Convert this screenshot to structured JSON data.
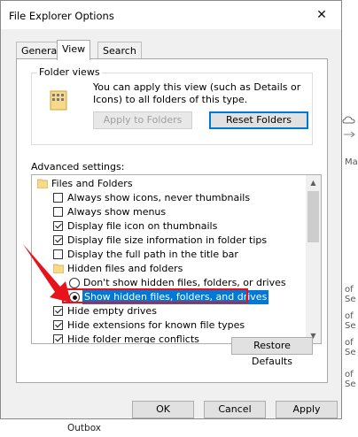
{
  "window": {
    "title": "File Explorer Options"
  },
  "tabs": [
    {
      "label": "General"
    },
    {
      "label": "View",
      "active": true
    },
    {
      "label": "Search"
    }
  ],
  "folder_views": {
    "label": "Folder views",
    "description": "You can apply this view (such as Details or Icons) to all folders of this type.",
    "apply_button": "Apply to Folders",
    "reset_button": "Reset Folders"
  },
  "advanced": {
    "label": "Advanced settings:",
    "items": [
      {
        "type": "folder",
        "text": "Files and Folders"
      },
      {
        "type": "checkbox",
        "checked": false,
        "text": "Always show icons, never thumbnails"
      },
      {
        "type": "checkbox",
        "checked": false,
        "text": "Always show menus"
      },
      {
        "type": "checkbox",
        "checked": true,
        "text": "Display file icon on thumbnails"
      },
      {
        "type": "checkbox",
        "checked": true,
        "text": "Display file size information in folder tips"
      },
      {
        "type": "checkbox",
        "checked": false,
        "text": "Display the full path in the title bar"
      },
      {
        "type": "folder",
        "text": "Hidden files and folders"
      },
      {
        "type": "radio",
        "checked": false,
        "text": "Don't show hidden files, folders, or drives"
      },
      {
        "type": "radio",
        "checked": true,
        "selected": true,
        "text": "Show hidden files, folders, and drives"
      },
      {
        "type": "checkbox",
        "checked": true,
        "text": "Hide empty drives"
      },
      {
        "type": "checkbox",
        "checked": true,
        "text": "Hide extensions for known file types"
      },
      {
        "type": "checkbox",
        "checked": true,
        "text": "Hide folder merge conflicts"
      }
    ],
    "restore_button": "Restore Defaults"
  },
  "footer": {
    "ok": "OK",
    "cancel": "Cancel",
    "apply": "Apply"
  },
  "background": {
    "outbox_label": "Outbox",
    "side_labels": [
      "Mai",
      "of Se",
      "of Se",
      "of Se",
      "of Se"
    ]
  },
  "colors": {
    "accent": "#0078d7",
    "highlight": "#e8121c",
    "desktop": "#0f5ca8"
  }
}
